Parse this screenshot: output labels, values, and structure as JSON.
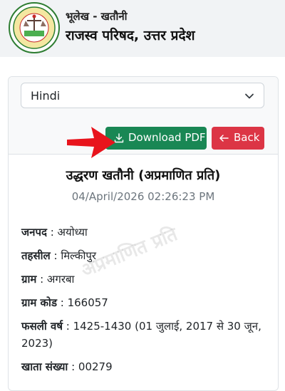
{
  "header": {
    "subtitle": "भूलेख - खतौनी",
    "title": "राजस्व परिषद, उत्तर प्रदेश",
    "logo_icon": "revenue-board-emblem"
  },
  "language_select": {
    "value": "Hindi"
  },
  "buttons": {
    "download_label": "Download PDF",
    "back_label": "Back"
  },
  "colors": {
    "download": "#198754",
    "back": "#dc3545",
    "arrow": "#e8141c"
  },
  "document": {
    "title": "उद्धरण खतौनी (अप्रमाणित प्रति)",
    "date": "04/April/2026 02:26:23 PM",
    "watermark": "अप्रमाणित प्रति",
    "fields": [
      {
        "label": "जनपद",
        "value": "अयोध्या"
      },
      {
        "label": "तहसील",
        "value": "मिल्कीपुर"
      },
      {
        "label": "ग्राम",
        "value": "अगरबा"
      },
      {
        "label": "ग्राम कोड",
        "value": "166057"
      },
      {
        "label": "फसली वर्ष",
        "value": "1425-1430 (01 जुलाई, 2017 से 30 जून, 2023)"
      },
      {
        "label": "खाता संख्या",
        "value": "00279"
      }
    ]
  }
}
